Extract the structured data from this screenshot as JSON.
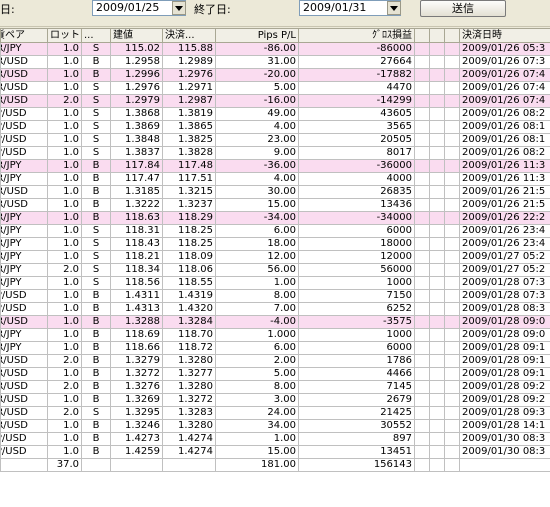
{
  "toolbar": {
    "start_label": "日:",
    "start_date": "2009/01/25",
    "end_label": "終了日:",
    "end_date": "2009/01/31",
    "send_button": "送信"
  },
  "table": {
    "headers": [
      "貨ペア",
      "ロット",
      "...",
      "建値",
      "決済...",
      "Pips P/L",
      "ｸﾞﾛｽ損益",
      "",
      "",
      "",
      "決済日時"
    ],
    "rows": [
      {
        "pair": "UR/JPY",
        "lot": "1.0",
        "side": "S",
        "open": "115.02",
        "close": "115.88",
        "pips": "-86.00",
        "pl": "-86000",
        "dt": "2009/01/26 05:3",
        "pink": true
      },
      {
        "pair": "UR/USD",
        "lot": "1.0",
        "side": "B",
        "open": "1.2958",
        "close": "1.2989",
        "pips": "31.00",
        "pl": "27664",
        "dt": "2009/01/26 07:3",
        "pink": false
      },
      {
        "pair": "UR/USD",
        "lot": "1.0",
        "side": "B",
        "open": "1.2996",
        "close": "1.2976",
        "pips": "-20.00",
        "pl": "-17882",
        "dt": "2009/01/26 07:4",
        "pink": true
      },
      {
        "pair": "UR/USD",
        "lot": "1.0",
        "side": "S",
        "open": "1.2976",
        "close": "1.2971",
        "pips": "5.00",
        "pl": "4470",
        "dt": "2009/01/26 07:4",
        "pink": false
      },
      {
        "pair": "UR/USD",
        "lot": "2.0",
        "side": "S",
        "open": "1.2979",
        "close": "1.2987",
        "pips": "-16.00",
        "pl": "-14299",
        "dt": "2009/01/26 07:4",
        "pink": true
      },
      {
        "pair": "BP/USD",
        "lot": "1.0",
        "side": "S",
        "open": "1.3868",
        "close": "1.3819",
        "pips": "49.00",
        "pl": "43605",
        "dt": "2009/01/26 08:2",
        "pink": false
      },
      {
        "pair": "BP/USD",
        "lot": "1.0",
        "side": "S",
        "open": "1.3869",
        "close": "1.3865",
        "pips": "4.00",
        "pl": "3565",
        "dt": "2009/01/26 08:1",
        "pink": false
      },
      {
        "pair": "BP/USD",
        "lot": "1.0",
        "side": "S",
        "open": "1.3848",
        "close": "1.3825",
        "pips": "23.00",
        "pl": "20505",
        "dt": "2009/01/26 08:1",
        "pink": false
      },
      {
        "pair": "BP/USD",
        "lot": "1.0",
        "side": "S",
        "open": "1.3837",
        "close": "1.3828",
        "pips": "9.00",
        "pl": "8017",
        "dt": "2009/01/26 08:2",
        "pink": false
      },
      {
        "pair": "UR/JPY",
        "lot": "1.0",
        "side": "B",
        "open": "117.84",
        "close": "117.48",
        "pips": "-36.00",
        "pl": "-36000",
        "dt": "2009/01/26 11:3",
        "pink": true
      },
      {
        "pair": "UR/JPY",
        "lot": "1.0",
        "side": "B",
        "open": "117.47",
        "close": "117.51",
        "pips": "4.00",
        "pl": "4000",
        "dt": "2009/01/26 11:3",
        "pink": false
      },
      {
        "pair": "UR/USD",
        "lot": "1.0",
        "side": "B",
        "open": "1.3185",
        "close": "1.3215",
        "pips": "30.00",
        "pl": "26835",
        "dt": "2009/01/26 21:5",
        "pink": false
      },
      {
        "pair": "UR/USD",
        "lot": "1.0",
        "side": "B",
        "open": "1.3222",
        "close": "1.3237",
        "pips": "15.00",
        "pl": "13436",
        "dt": "2009/01/26 21:5",
        "pink": false
      },
      {
        "pair": "UR/JPY",
        "lot": "1.0",
        "side": "B",
        "open": "118.63",
        "close": "118.29",
        "pips": "-34.00",
        "pl": "-34000",
        "dt": "2009/01/26 22:2",
        "pink": true
      },
      {
        "pair": "UR/JPY",
        "lot": "1.0",
        "side": "S",
        "open": "118.31",
        "close": "118.25",
        "pips": "6.00",
        "pl": "6000",
        "dt": "2009/01/26 23:4",
        "pink": false
      },
      {
        "pair": "UR/JPY",
        "lot": "1.0",
        "side": "S",
        "open": "118.43",
        "close": "118.25",
        "pips": "18.00",
        "pl": "18000",
        "dt": "2009/01/26 23:4",
        "pink": false
      },
      {
        "pair": "UR/JPY",
        "lot": "1.0",
        "side": "S",
        "open": "118.21",
        "close": "118.09",
        "pips": "12.00",
        "pl": "12000",
        "dt": "2009/01/27 05:2",
        "pink": false
      },
      {
        "pair": "UR/JPY",
        "lot": "2.0",
        "side": "S",
        "open": "118.34",
        "close": "118.06",
        "pips": "56.00",
        "pl": "56000",
        "dt": "2009/01/27 05:2",
        "pink": false
      },
      {
        "pair": "UR/JPY",
        "lot": "1.0",
        "side": "S",
        "open": "118.56",
        "close": "118.55",
        "pips": "1.00",
        "pl": "1000",
        "dt": "2009/01/28 07:3",
        "pink": false
      },
      {
        "pair": "BP/USD",
        "lot": "1.0",
        "side": "B",
        "open": "1.4311",
        "close": "1.4319",
        "pips": "8.00",
        "pl": "7150",
        "dt": "2009/01/28 07:3",
        "pink": false
      },
      {
        "pair": "BP/USD",
        "lot": "1.0",
        "side": "B",
        "open": "1.4313",
        "close": "1.4320",
        "pips": "7.00",
        "pl": "6252",
        "dt": "2009/01/28 08:3",
        "pink": false
      },
      {
        "pair": "UR/USD",
        "lot": "1.0",
        "side": "B",
        "open": "1.3288",
        "close": "1.3284",
        "pips": "-4.00",
        "pl": "-3575",
        "dt": "2009/01/28 09:0",
        "pink": true
      },
      {
        "pair": "UR/JPY",
        "lot": "1.0",
        "side": "B",
        "open": "118.69",
        "close": "118.70",
        "pips": "1.000",
        "pl": "1000",
        "dt": "2009/01/28 09:0",
        "pink": false
      },
      {
        "pair": "UR/JPY",
        "lot": "1.0",
        "side": "B",
        "open": "118.66",
        "close": "118.72",
        "pips": "6.00",
        "pl": "6000",
        "dt": "2009/01/28 09:1",
        "pink": false
      },
      {
        "pair": "UR/USD",
        "lot": "2.0",
        "side": "B",
        "open": "1.3279",
        "close": "1.3280",
        "pips": "2.00",
        "pl": "1786",
        "dt": "2009/01/28 09:1",
        "pink": false
      },
      {
        "pair": "UR/USD",
        "lot": "1.0",
        "side": "B",
        "open": "1.3272",
        "close": "1.3277",
        "pips": "5.00",
        "pl": "4466",
        "dt": "2009/01/28 09:1",
        "pink": false
      },
      {
        "pair": "UR/USD",
        "lot": "2.0",
        "side": "B",
        "open": "1.3276",
        "close": "1.3280",
        "pips": "8.00",
        "pl": "7145",
        "dt": "2009/01/28 09:2",
        "pink": false
      },
      {
        "pair": "UR/USD",
        "lot": "1.0",
        "side": "B",
        "open": "1.3269",
        "close": "1.3272",
        "pips": "3.00",
        "pl": "2679",
        "dt": "2009/01/28 09:2",
        "pink": false
      },
      {
        "pair": "UR/USD",
        "lot": "2.0",
        "side": "S",
        "open": "1.3295",
        "close": "1.3283",
        "pips": "24.00",
        "pl": "21425",
        "dt": "2009/01/28 09:3",
        "pink": false
      },
      {
        "pair": "UR/USD",
        "lot": "1.0",
        "side": "B",
        "open": "1.3246",
        "close": "1.3280",
        "pips": "34.00",
        "pl": "30552",
        "dt": "2009/01/28 14:1",
        "pink": false
      },
      {
        "pair": "BP/USD",
        "lot": "1.0",
        "side": "B",
        "open": "1.4273",
        "close": "1.4274",
        "pips": "1.00",
        "pl": "897",
        "dt": "2009/01/30 08:3",
        "pink": false
      },
      {
        "pair": "BP/USD",
        "lot": "1.0",
        "side": "B",
        "open": "1.4259",
        "close": "1.4274",
        "pips": "15.00",
        "pl": "13451",
        "dt": "2009/01/30 08:3",
        "pink": false
      }
    ],
    "totals": {
      "lot": "37.0",
      "pips": "181.00",
      "pl": "156143"
    }
  }
}
